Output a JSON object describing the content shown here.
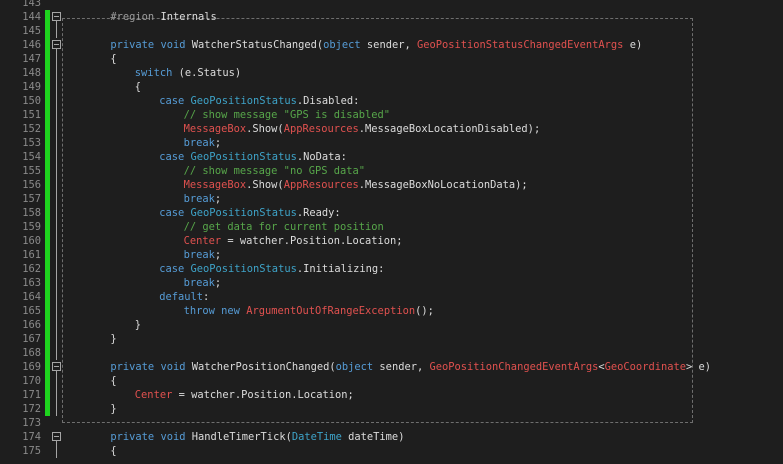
{
  "editor": {
    "lines": [
      {
        "n": "143",
        "chg": false,
        "fold": "",
        "indent": 0,
        "tokens": []
      },
      {
        "n": "144",
        "chg": true,
        "fold": "box",
        "indent": 4,
        "tokens": [
          {
            "t": "#region",
            "c": "pre"
          },
          {
            "t": " Internals",
            "c": "plain"
          }
        ]
      },
      {
        "n": "145",
        "chg": true,
        "fold": "line",
        "indent": 0,
        "tokens": []
      },
      {
        "n": "146",
        "chg": true,
        "fold": "box",
        "indent": 4,
        "tokens": [
          {
            "t": "private",
            "c": "kw"
          },
          {
            "t": " ",
            "c": "plain"
          },
          {
            "t": "void",
            "c": "kw"
          },
          {
            "t": " WatcherStatusChanged(",
            "c": "plain"
          },
          {
            "t": "object",
            "c": "kw"
          },
          {
            "t": " sender, ",
            "c": "plain"
          },
          {
            "t": "GeoPositionStatusChangedEventArgs",
            "c": "err"
          },
          {
            "t": " e)",
            "c": "plain"
          }
        ]
      },
      {
        "n": "147",
        "chg": true,
        "fold": "line",
        "indent": 4,
        "tokens": [
          {
            "t": "{",
            "c": "plain"
          }
        ]
      },
      {
        "n": "148",
        "chg": true,
        "fold": "line",
        "indent": 8,
        "tokens": [
          {
            "t": "switch",
            "c": "kw"
          },
          {
            "t": " (e.Status)",
            "c": "plain"
          }
        ]
      },
      {
        "n": "149",
        "chg": true,
        "fold": "line",
        "indent": 8,
        "tokens": [
          {
            "t": "{",
            "c": "plain"
          }
        ]
      },
      {
        "n": "150",
        "chg": true,
        "fold": "line",
        "indent": 12,
        "tokens": [
          {
            "t": "case",
            "c": "kw"
          },
          {
            "t": " ",
            "c": "plain"
          },
          {
            "t": "GeoPositionStatus",
            "c": "ty2"
          },
          {
            "t": ".Disabled:",
            "c": "plain"
          }
        ]
      },
      {
        "n": "151",
        "chg": true,
        "fold": "line",
        "indent": 16,
        "tokens": [
          {
            "t": "// show message \"GPS is disabled\"",
            "c": "cm"
          }
        ]
      },
      {
        "n": "152",
        "chg": true,
        "fold": "line",
        "indent": 16,
        "tokens": [
          {
            "t": "MessageBox",
            "c": "err"
          },
          {
            "t": ".Show(",
            "c": "plain"
          },
          {
            "t": "AppResources",
            "c": "err"
          },
          {
            "t": ".MessageBoxLocationDisabled);",
            "c": "plain"
          }
        ]
      },
      {
        "n": "153",
        "chg": true,
        "fold": "line",
        "indent": 16,
        "tokens": [
          {
            "t": "break",
            "c": "kw"
          },
          {
            "t": ";",
            "c": "plain"
          }
        ]
      },
      {
        "n": "154",
        "chg": true,
        "fold": "line",
        "indent": 12,
        "tokens": [
          {
            "t": "case",
            "c": "kw"
          },
          {
            "t": " ",
            "c": "plain"
          },
          {
            "t": "GeoPositionStatus",
            "c": "ty2"
          },
          {
            "t": ".NoData:",
            "c": "plain"
          }
        ]
      },
      {
        "n": "155",
        "chg": true,
        "fold": "line",
        "indent": 16,
        "tokens": [
          {
            "t": "// show message \"no GPS data\"",
            "c": "cm"
          }
        ]
      },
      {
        "n": "156",
        "chg": true,
        "fold": "line",
        "indent": 16,
        "tokens": [
          {
            "t": "MessageBox",
            "c": "err"
          },
          {
            "t": ".Show(",
            "c": "plain"
          },
          {
            "t": "AppResources",
            "c": "err"
          },
          {
            "t": ".MessageBoxNoLocationData);",
            "c": "plain"
          }
        ]
      },
      {
        "n": "157",
        "chg": true,
        "fold": "line",
        "indent": 16,
        "tokens": [
          {
            "t": "break",
            "c": "kw"
          },
          {
            "t": ";",
            "c": "plain"
          }
        ]
      },
      {
        "n": "158",
        "chg": true,
        "fold": "line",
        "indent": 12,
        "tokens": [
          {
            "t": "case",
            "c": "kw"
          },
          {
            "t": " ",
            "c": "plain"
          },
          {
            "t": "GeoPositionStatus",
            "c": "ty2"
          },
          {
            "t": ".Ready:",
            "c": "plain"
          }
        ]
      },
      {
        "n": "159",
        "chg": true,
        "fold": "line",
        "indent": 16,
        "tokens": [
          {
            "t": "// get data for current position",
            "c": "cm"
          }
        ]
      },
      {
        "n": "160",
        "chg": true,
        "fold": "line",
        "indent": 16,
        "tokens": [
          {
            "t": "Center",
            "c": "err"
          },
          {
            "t": " = watcher.Position.Location;",
            "c": "plain"
          }
        ]
      },
      {
        "n": "161",
        "chg": true,
        "fold": "line",
        "indent": 16,
        "tokens": [
          {
            "t": "break",
            "c": "kw"
          },
          {
            "t": ";",
            "c": "plain"
          }
        ]
      },
      {
        "n": "162",
        "chg": true,
        "fold": "line",
        "indent": 12,
        "tokens": [
          {
            "t": "case",
            "c": "kw"
          },
          {
            "t": " ",
            "c": "plain"
          },
          {
            "t": "GeoPositionStatus",
            "c": "ty2"
          },
          {
            "t": ".Initializing:",
            "c": "plain"
          }
        ]
      },
      {
        "n": "163",
        "chg": true,
        "fold": "line",
        "indent": 16,
        "tokens": [
          {
            "t": "break",
            "c": "kw"
          },
          {
            "t": ";",
            "c": "plain"
          }
        ]
      },
      {
        "n": "164",
        "chg": true,
        "fold": "line",
        "indent": 12,
        "tokens": [
          {
            "t": "default",
            "c": "kw"
          },
          {
            "t": ":",
            "c": "plain"
          }
        ]
      },
      {
        "n": "165",
        "chg": true,
        "fold": "line",
        "indent": 16,
        "tokens": [
          {
            "t": "throw",
            "c": "kw"
          },
          {
            "t": " ",
            "c": "plain"
          },
          {
            "t": "new",
            "c": "kw"
          },
          {
            "t": " ",
            "c": "plain"
          },
          {
            "t": "ArgumentOutOfRangeException",
            "c": "err"
          },
          {
            "t": "();",
            "c": "plain"
          }
        ]
      },
      {
        "n": "166",
        "chg": true,
        "fold": "line",
        "indent": 8,
        "tokens": [
          {
            "t": "}",
            "c": "plain"
          }
        ]
      },
      {
        "n": "167",
        "chg": true,
        "fold": "line",
        "indent": 4,
        "tokens": [
          {
            "t": "}",
            "c": "plain"
          }
        ]
      },
      {
        "n": "168",
        "chg": true,
        "fold": "line",
        "indent": 0,
        "tokens": []
      },
      {
        "n": "169",
        "chg": true,
        "fold": "box",
        "indent": 4,
        "tokens": [
          {
            "t": "private",
            "c": "kw"
          },
          {
            "t": " ",
            "c": "plain"
          },
          {
            "t": "void",
            "c": "kw"
          },
          {
            "t": " WatcherPositionChanged(",
            "c": "plain"
          },
          {
            "t": "object",
            "c": "kw"
          },
          {
            "t": " sender, ",
            "c": "plain"
          },
          {
            "t": "GeoPositionChangedEventArgs",
            "c": "err"
          },
          {
            "t": "<",
            "c": "plain"
          },
          {
            "t": "GeoCoordinate",
            "c": "err"
          },
          {
            "t": "> e)",
            "c": "plain"
          }
        ]
      },
      {
        "n": "170",
        "chg": true,
        "fold": "line",
        "indent": 4,
        "tokens": [
          {
            "t": "{",
            "c": "plain"
          }
        ]
      },
      {
        "n": "171",
        "chg": true,
        "fold": "line",
        "indent": 8,
        "tokens": [
          {
            "t": "Center",
            "c": "err"
          },
          {
            "t": " = watcher.Position.Location;",
            "c": "plain"
          }
        ]
      },
      {
        "n": "172",
        "chg": true,
        "fold": "line",
        "indent": 4,
        "tokens": [
          {
            "t": "}",
            "c": "plain"
          }
        ]
      },
      {
        "n": "173",
        "chg": false,
        "fold": "",
        "indent": 0,
        "tokens": []
      },
      {
        "n": "174",
        "chg": false,
        "fold": "box",
        "indent": 4,
        "tokens": [
          {
            "t": "private",
            "c": "kw"
          },
          {
            "t": " ",
            "c": "plain"
          },
          {
            "t": "void",
            "c": "kw"
          },
          {
            "t": " HandleTimerTick(",
            "c": "plain"
          },
          {
            "t": "DateTime",
            "c": "ty2"
          },
          {
            "t": " dateTime)",
            "c": "plain"
          }
        ]
      },
      {
        "n": "175",
        "chg": false,
        "fold": "line",
        "indent": 4,
        "tokens": [
          {
            "t": "{",
            "c": "plain"
          }
        ]
      }
    ]
  }
}
